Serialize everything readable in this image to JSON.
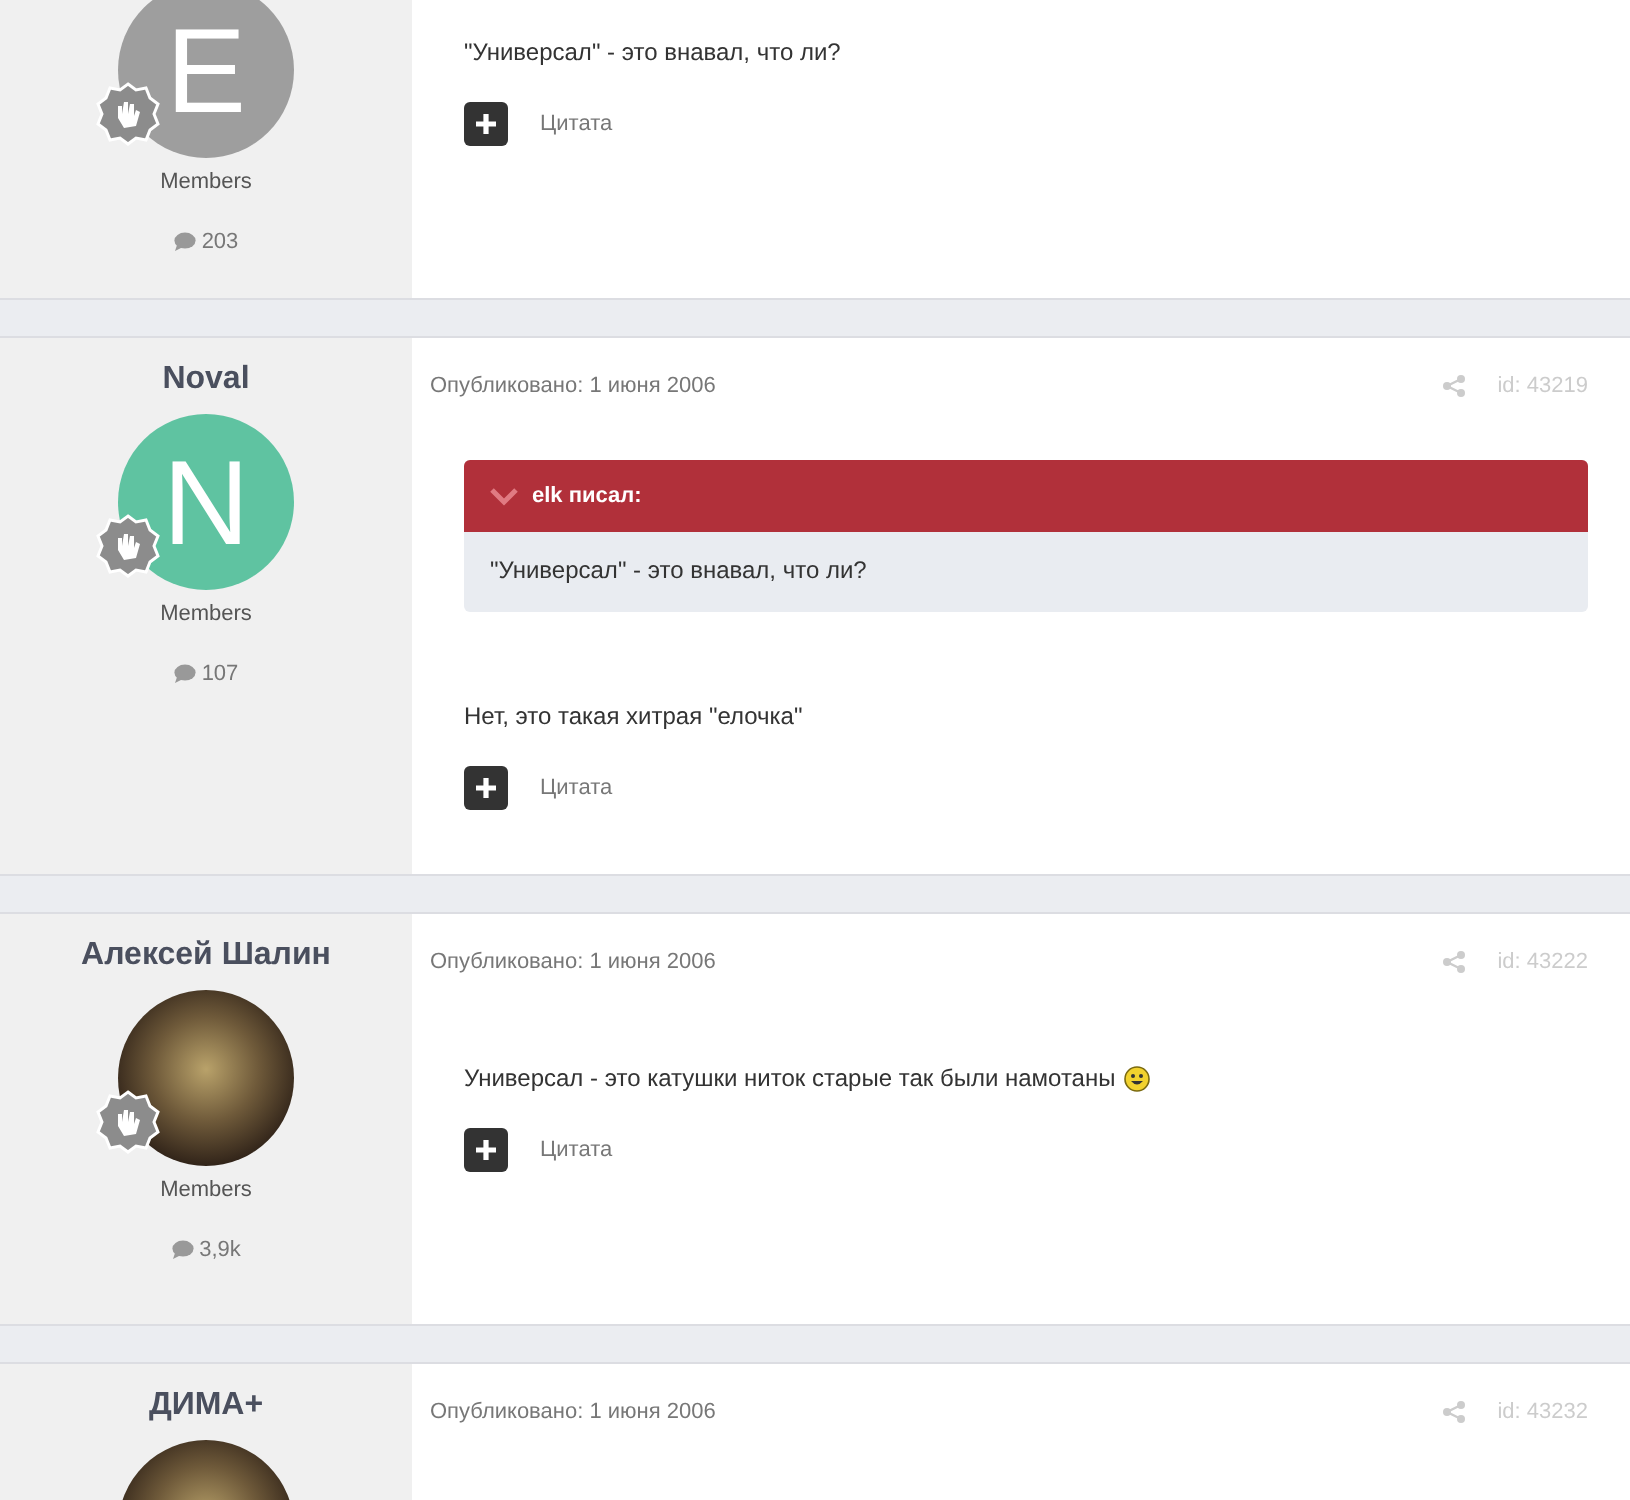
{
  "posts": [
    {
      "avatar": {
        "kind": "letter",
        "letter": "E",
        "color": "#9e9e9e"
      },
      "group": "Members",
      "post_count": "203",
      "body": "\"Универсал\" - это внавал, что ли?",
      "quote_button": "Цитата"
    },
    {
      "author": "Noval",
      "avatar": {
        "kind": "letter",
        "letter": "N",
        "color": "#5fc3a1"
      },
      "group": "Members",
      "post_count": "107",
      "date": "Опубликовано: 1 июня 2006",
      "id": "id: 43219",
      "quote": {
        "header": "elk писал:",
        "text": "\"Универсал\" - это внавал, что ли?"
      },
      "body": "Нет, это такая хитрая \"елочка\"",
      "quote_button": "Цитата"
    },
    {
      "author": "Алексей Шалин",
      "avatar": {
        "kind": "photo"
      },
      "group": "Members",
      "post_count": "3,9k",
      "date": "Опубликовано: 1 июня 2006",
      "id": "id: 43222",
      "body": "Универсал - это катушки ниток старые так были намотаны",
      "has_emoji": true,
      "quote_button": "Цитата"
    },
    {
      "author": "ДИМА+",
      "avatar": {
        "kind": "photo"
      },
      "date": "Опубликовано: 1 июня 2006",
      "id": "id: 43232"
    }
  ]
}
